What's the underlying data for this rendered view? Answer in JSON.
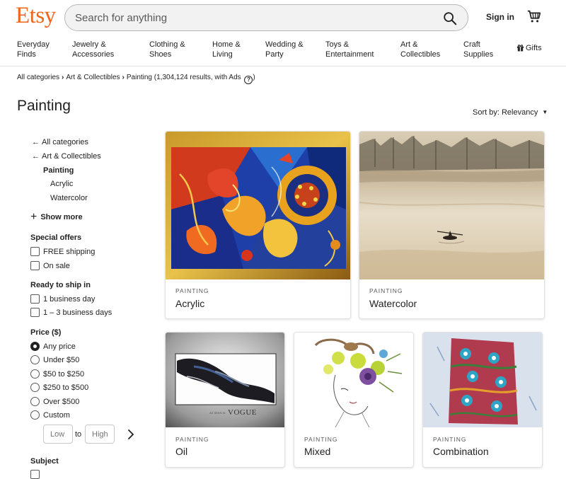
{
  "header": {
    "logo": "Etsy",
    "search_placeholder": "Search for anything",
    "signin_label": "Sign in",
    "icons": {
      "search": "search-icon",
      "cart": "cart-icon"
    }
  },
  "nav": {
    "items": [
      {
        "line1": "Everyday",
        "line2": "Finds"
      },
      {
        "line1": "Jewelry &",
        "line2": "Accessories"
      },
      {
        "line1": "Clothing &",
        "line2": "Shoes"
      },
      {
        "line1": "Home &",
        "line2": "Living"
      },
      {
        "line1": "Wedding &",
        "line2": "Party"
      },
      {
        "line1": "Toys &",
        "line2": "Entertainment"
      },
      {
        "line1": "Art &",
        "line2": "Collectibles"
      },
      {
        "line1": "Craft",
        "line2": "Supplies"
      }
    ],
    "gifts_label": "Gifts"
  },
  "breadcrumb": {
    "items": [
      "All categories",
      "Art & Collectibles",
      "Painting"
    ],
    "results": "(1,304,124 results, with Ads"
  },
  "page_title": "Painting",
  "sort_label": "Sort by: Relevancy",
  "sidebar": {
    "back_links": [
      "All categories",
      "Art & Collectibles"
    ],
    "current": "Painting",
    "subcategories": [
      "Acrylic",
      "Watercolor"
    ],
    "show_more": "Show more",
    "special_offers": {
      "heading": "Special offers",
      "options": [
        "FREE shipping",
        "On sale"
      ]
    },
    "ready_to_ship": {
      "heading": "Ready to ship in",
      "options": [
        "1 business day",
        "1 – 3 business days"
      ]
    },
    "price": {
      "heading": "Price ($)",
      "options": [
        "Any price",
        "Under $50",
        "$50 to $250",
        "$250 to $500",
        "Over $500",
        "Custom"
      ],
      "selected": "Any price",
      "low_placeholder": "Low",
      "high_placeholder": "High",
      "to_label": "to"
    },
    "subject": {
      "heading": "Subject"
    }
  },
  "cards": [
    {
      "kicker": "PAINTING",
      "title": "Acrylic"
    },
    {
      "kicker": "PAINTING",
      "title": "Watercolor"
    },
    {
      "kicker": "PAINTING",
      "title": "Oil"
    },
    {
      "kicker": "PAINTING",
      "title": "Mixed"
    },
    {
      "kicker": "PAINTING",
      "title": "Combination"
    }
  ],
  "colors": {
    "brand": "#f1641e",
    "text": "#222222",
    "muted": "#595959"
  }
}
